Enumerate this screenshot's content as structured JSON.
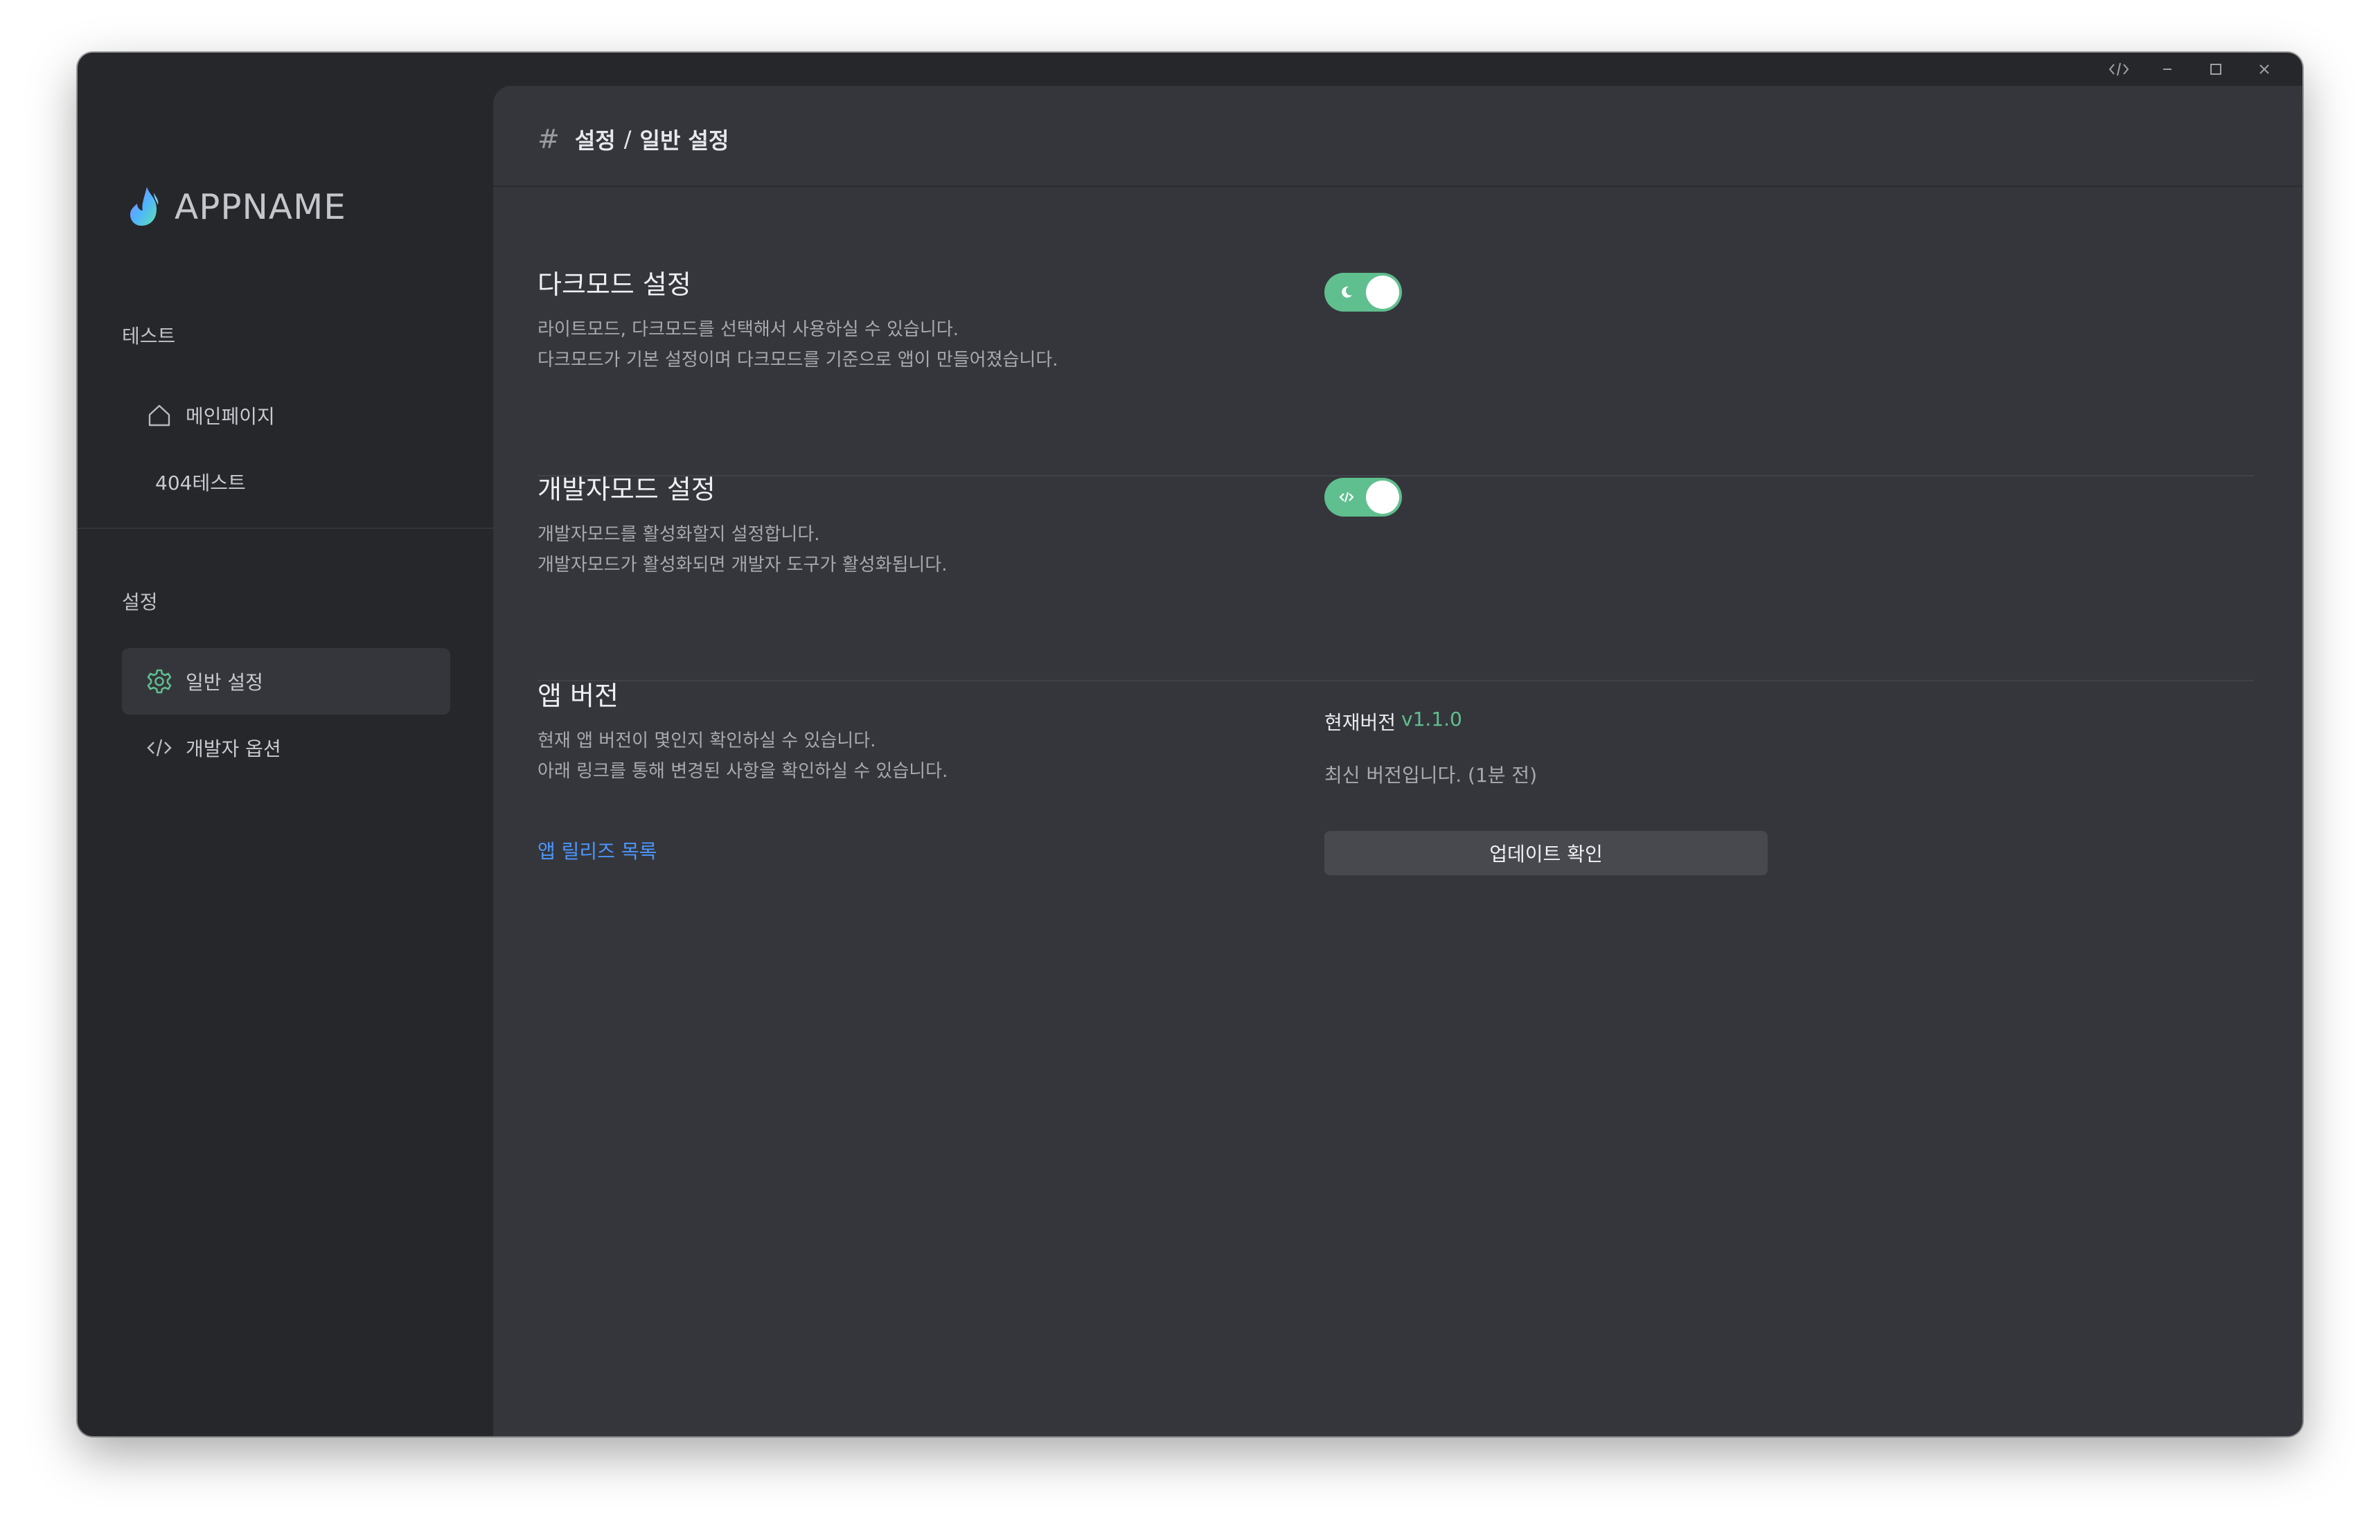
{
  "app": {
    "name": "APPNAME"
  },
  "titlebar": {
    "icons": [
      "code-icon",
      "minimize-icon",
      "maximize-icon",
      "close-icon"
    ]
  },
  "sidebar": {
    "sections": [
      {
        "title": "테스트",
        "items": [
          {
            "label": "메인페이지",
            "icon": "home-icon",
            "active": false
          },
          {
            "label": "404테스트",
            "icon": "",
            "active": false
          }
        ]
      },
      {
        "title": "설정",
        "items": [
          {
            "label": "일반 설정",
            "icon": "gear-icon",
            "active": true
          },
          {
            "label": "개발자 옵션",
            "icon": "code-icon",
            "active": false
          }
        ]
      }
    ]
  },
  "header": {
    "icon": "hash-icon",
    "parent": "설정",
    "separator": "/",
    "current": "일반 설정"
  },
  "settings": {
    "dark_mode": {
      "title": "다크모드 설정",
      "desc_line1": "라이트모드, 다크모드를 선택해서 사용하실 수 있습니다.",
      "desc_line2": "다크모드가 기본 설정이며 다크모드를 기준으로 앱이 만들어졌습니다.",
      "enabled": true,
      "toggle_icon": "moon-icon"
    },
    "dev_mode": {
      "title": "개발자모드 설정",
      "desc_line1": "개발자모드를 활성화할지 설정합니다.",
      "desc_line2": "개발자모드가 활성화되면 개발자 도구가 활성화됩니다.",
      "enabled": true,
      "toggle_icon": "code-icon"
    },
    "app_version": {
      "title": "앱 버전",
      "desc_line1": "현재 앱 버전이 몇인지 확인하실 수 있습니다.",
      "desc_line2": "아래 링크를 통해 변경된 사항을 확인하실 수 있습니다.",
      "release_link": "앱 릴리즈 목록",
      "current_label": "현재버전",
      "current_value": "v1.1.0",
      "latest_status": "최신 버전입니다. (1분 전)",
      "update_button": "업데이트 확인"
    }
  },
  "colors": {
    "accent": "#5fbf8e",
    "link": "#4a97ff",
    "sidebar_bg": "#26272b",
    "main_bg": "#35363b"
  }
}
